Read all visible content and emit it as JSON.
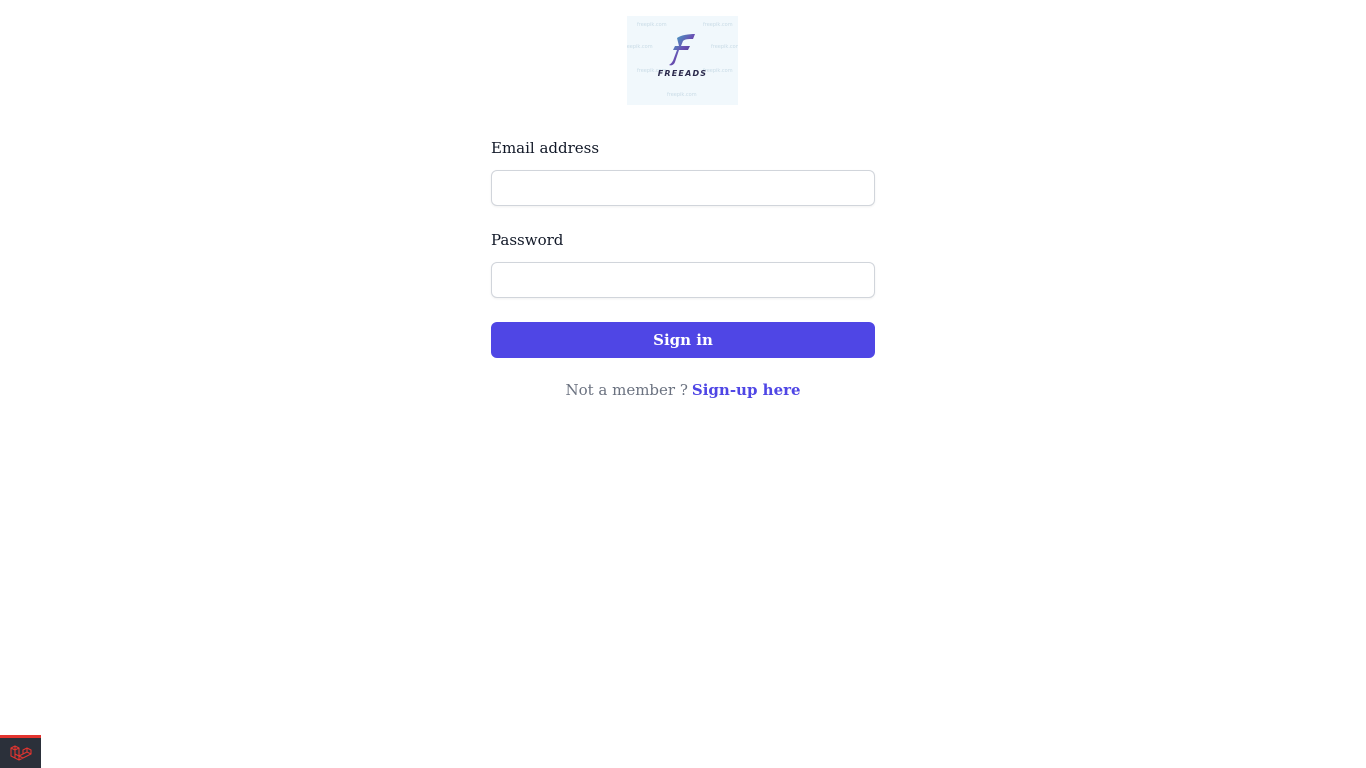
{
  "logo": {
    "wordmark": "FREEADS",
    "icon": "freeads-f-logo-icon",
    "watermark": "freepik.com",
    "background": "#f1f8fc"
  },
  "form": {
    "email_label": "Email address",
    "email_value": "",
    "password_label": "Password",
    "password_value": "",
    "submit_label": "Sign in"
  },
  "signup": {
    "prompt": "Not a member ?",
    "link_label": "Sign-up here"
  },
  "debugbar": {
    "icon": "laravel-icon",
    "accent": "#e3342f"
  },
  "colors": {
    "primary": "#4f46e5",
    "muted_text": "#6b7280",
    "input_border": "#d1d5db"
  }
}
